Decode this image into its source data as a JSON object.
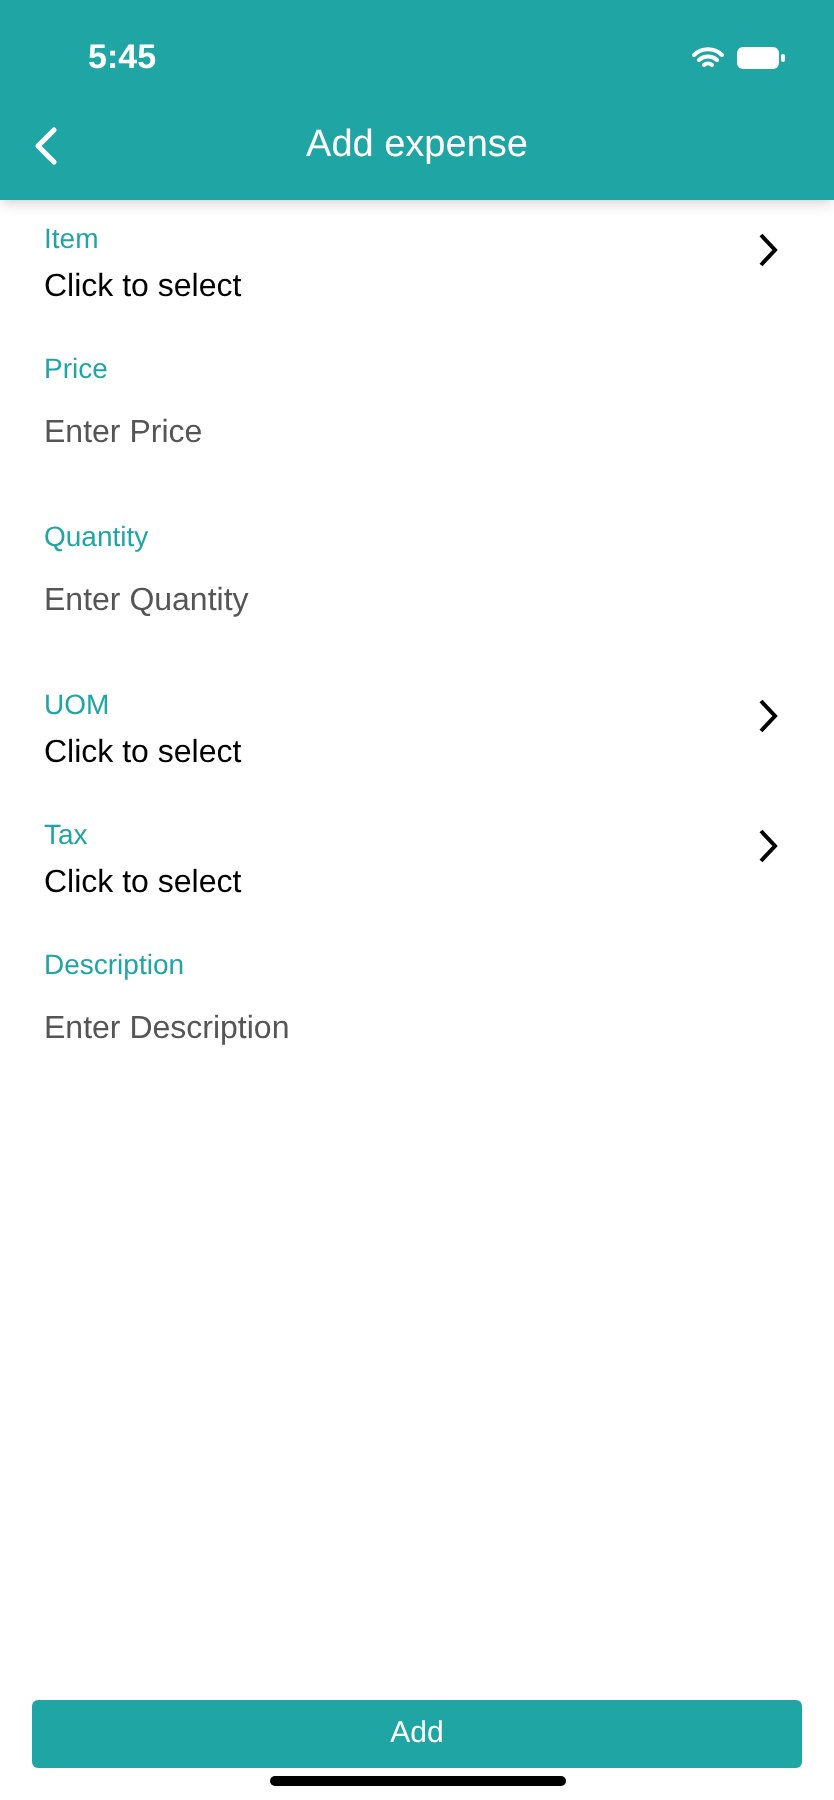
{
  "status_bar": {
    "time": "5:45"
  },
  "header": {
    "title": "Add expense"
  },
  "fields": [
    {
      "kind": "select",
      "label": "Item",
      "value": "Click to select"
    },
    {
      "kind": "input",
      "label": "Price",
      "placeholder": "Enter Price"
    },
    {
      "kind": "input",
      "label": "Quantity",
      "placeholder": "Enter Quantity"
    },
    {
      "kind": "select",
      "label": "UOM",
      "value": "Click to select"
    },
    {
      "kind": "select",
      "label": "Tax",
      "value": "Click to select"
    },
    {
      "kind": "input",
      "label": "Description",
      "placeholder": "Enter Description"
    }
  ],
  "button": {
    "label": "Add"
  }
}
